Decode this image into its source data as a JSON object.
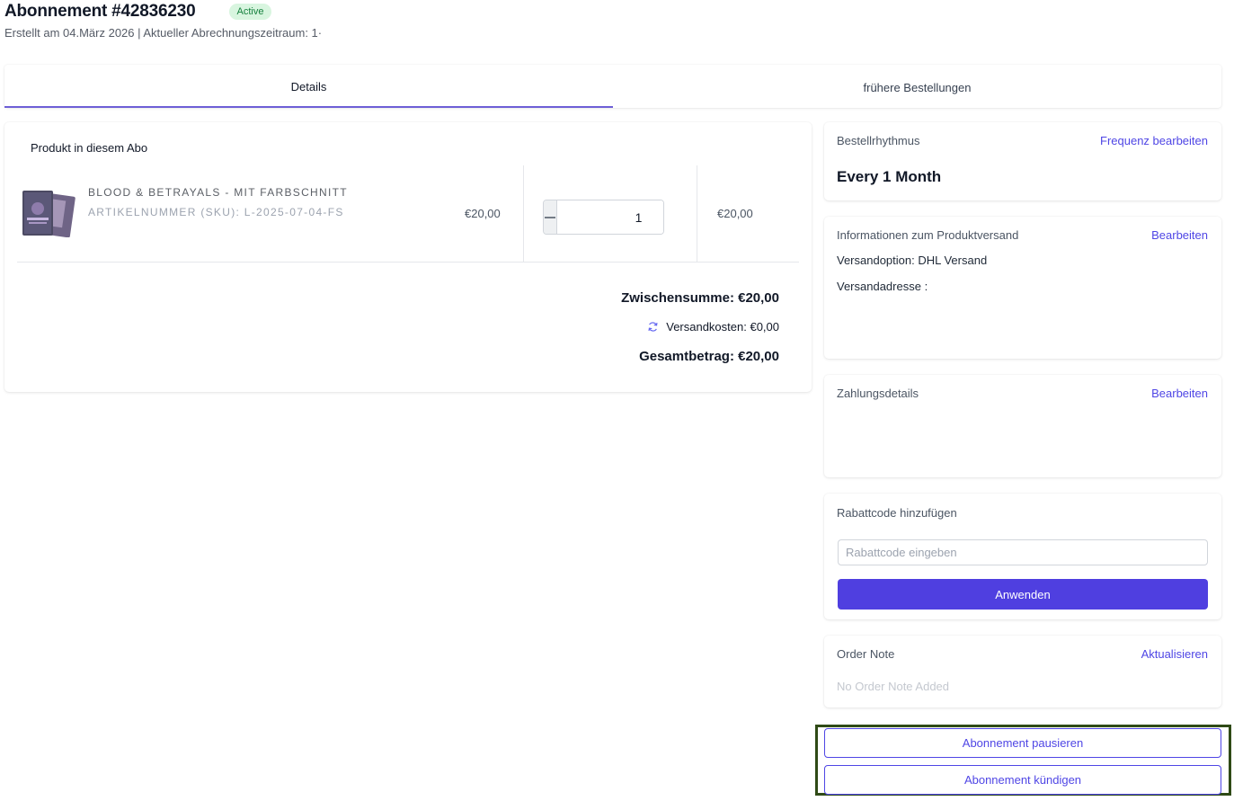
{
  "header": {
    "title": "Abonnement #42836230",
    "status": "Active",
    "subtitle": "Erstellt am 04.März 2026 | Aktueller Abrechnungszeitraum: 1·"
  },
  "tabs": [
    {
      "label": "Details",
      "active": true
    },
    {
      "label": "frühere Bestellungen",
      "active": false
    }
  ],
  "products": {
    "title": "Produkt in diesem Abo",
    "items": [
      {
        "name": "BLOOD & BETRAYALS - MIT FARBSCHNITT",
        "sku": "ARTIKELNUMMER (SKU): L-2025-07-04-FS",
        "price": "€20,00",
        "quantity": "1",
        "total": "€20,00"
      }
    ],
    "summary": {
      "subtotal": "Zwischensumme: €20,00",
      "shipping": "Versandkosten: €0,00",
      "total": "Gesamtbetrag: €20,00"
    }
  },
  "rhythm": {
    "label": "Bestellrhythmus",
    "link": "Frequenz bearbeiten",
    "value": "Every 1 Month"
  },
  "shipping_info": {
    "label": "Informationen zum Produktversand",
    "link": "Bearbeiten",
    "option": "Versandoption: DHL Versand",
    "address": "Versandadresse :"
  },
  "payment": {
    "label": "Zahlungsdetails",
    "link": "Bearbeiten"
  },
  "coupon": {
    "label": "Rabattcode hinzufügen",
    "placeholder": "Rabattcode eingeben",
    "button": "Anwenden"
  },
  "order_note": {
    "label": "Order Note",
    "link": "Aktualisieren",
    "empty": "No Order Note Added"
  },
  "actions": {
    "pause": "Abonnement pausieren",
    "cancel": "Abonnement kündigen"
  },
  "colors": {
    "accent": "#4f46e5",
    "primary_button": "#4f3fe0",
    "active_badge_bg": "#d8f5df",
    "active_badge_text": "#15803d",
    "highlight_frame": "#2f4a16"
  },
  "icons": [
    "sync-icon",
    "minus-icon",
    "plus-icon",
    "book-cover-image"
  ]
}
